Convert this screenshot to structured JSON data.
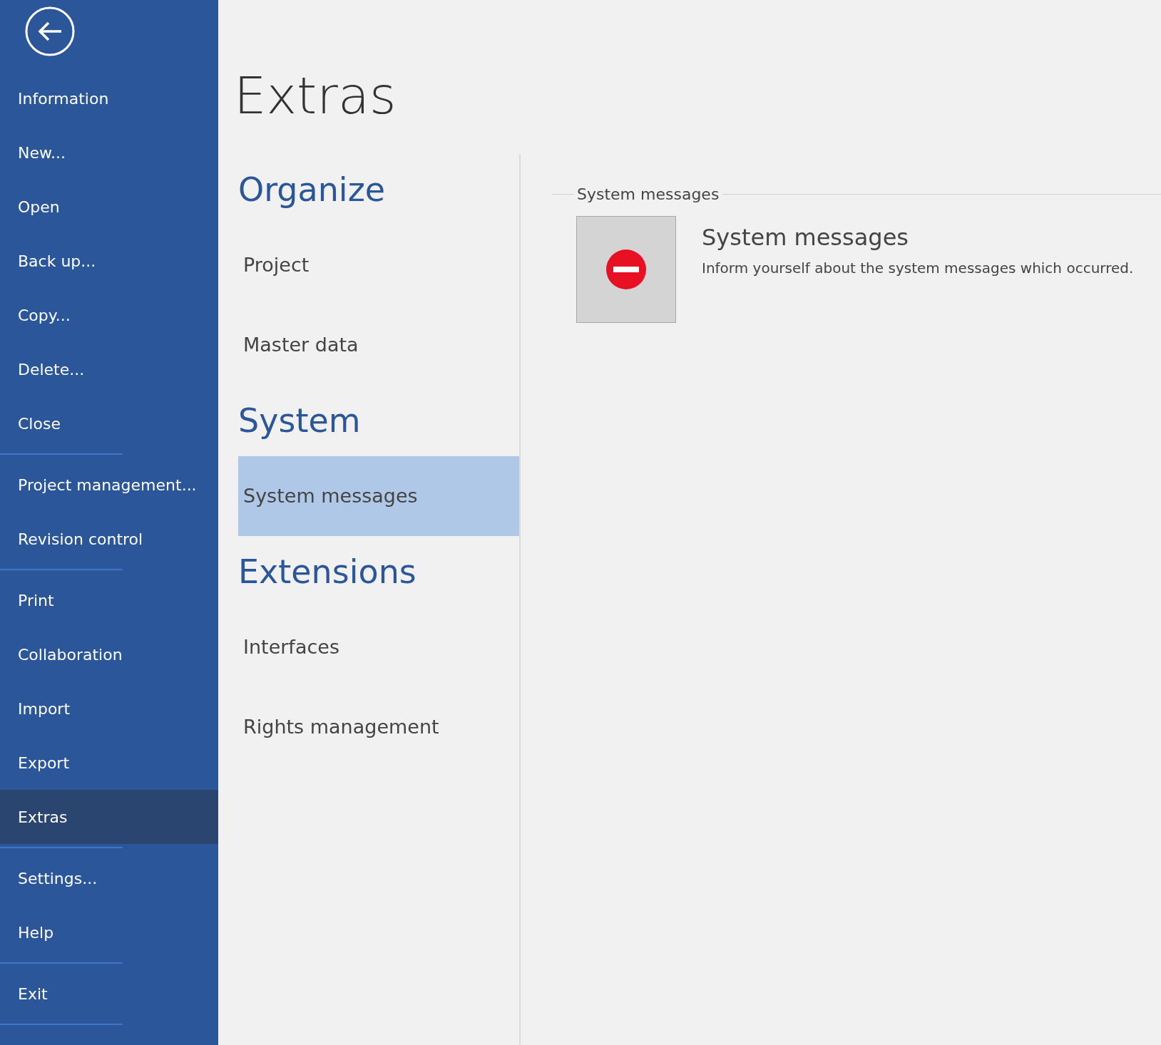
{
  "sidebar": {
    "groups": [
      [
        {
          "label": "Information",
          "selected": false
        },
        {
          "label": "New...",
          "selected": false
        },
        {
          "label": "Open",
          "selected": false
        },
        {
          "label": "Back up...",
          "selected": false
        },
        {
          "label": "Copy...",
          "selected": false
        },
        {
          "label": "Delete...",
          "selected": false
        },
        {
          "label": "Close",
          "selected": false
        }
      ],
      [
        {
          "label": "Project management...",
          "selected": false
        },
        {
          "label": "Revision control",
          "selected": false
        }
      ],
      [
        {
          "label": "Print",
          "selected": false
        },
        {
          "label": "Collaboration",
          "selected": false
        },
        {
          "label": "Import",
          "selected": false
        },
        {
          "label": "Export",
          "selected": false
        },
        {
          "label": "Extras",
          "selected": true
        }
      ],
      [
        {
          "label": "Settings...",
          "selected": false
        },
        {
          "label": "Help",
          "selected": false
        }
      ],
      [
        {
          "label": "Exit",
          "selected": false
        }
      ]
    ]
  },
  "page_title": "Extras",
  "sections": [
    {
      "heading": "Organize",
      "items": [
        {
          "label": "Project",
          "selected": false
        },
        {
          "label": "Master data",
          "selected": false
        }
      ]
    },
    {
      "heading": "System",
      "items": [
        {
          "label": "System messages",
          "selected": true
        }
      ]
    },
    {
      "heading": "Extensions",
      "items": [
        {
          "label": "Interfaces",
          "selected": false
        },
        {
          "label": "Rights management",
          "selected": false
        }
      ]
    }
  ],
  "detail": {
    "group_label": "System messages",
    "tiles": [
      {
        "title": "System messages",
        "description": "Inform yourself about the system messages which occurred."
      }
    ]
  }
}
